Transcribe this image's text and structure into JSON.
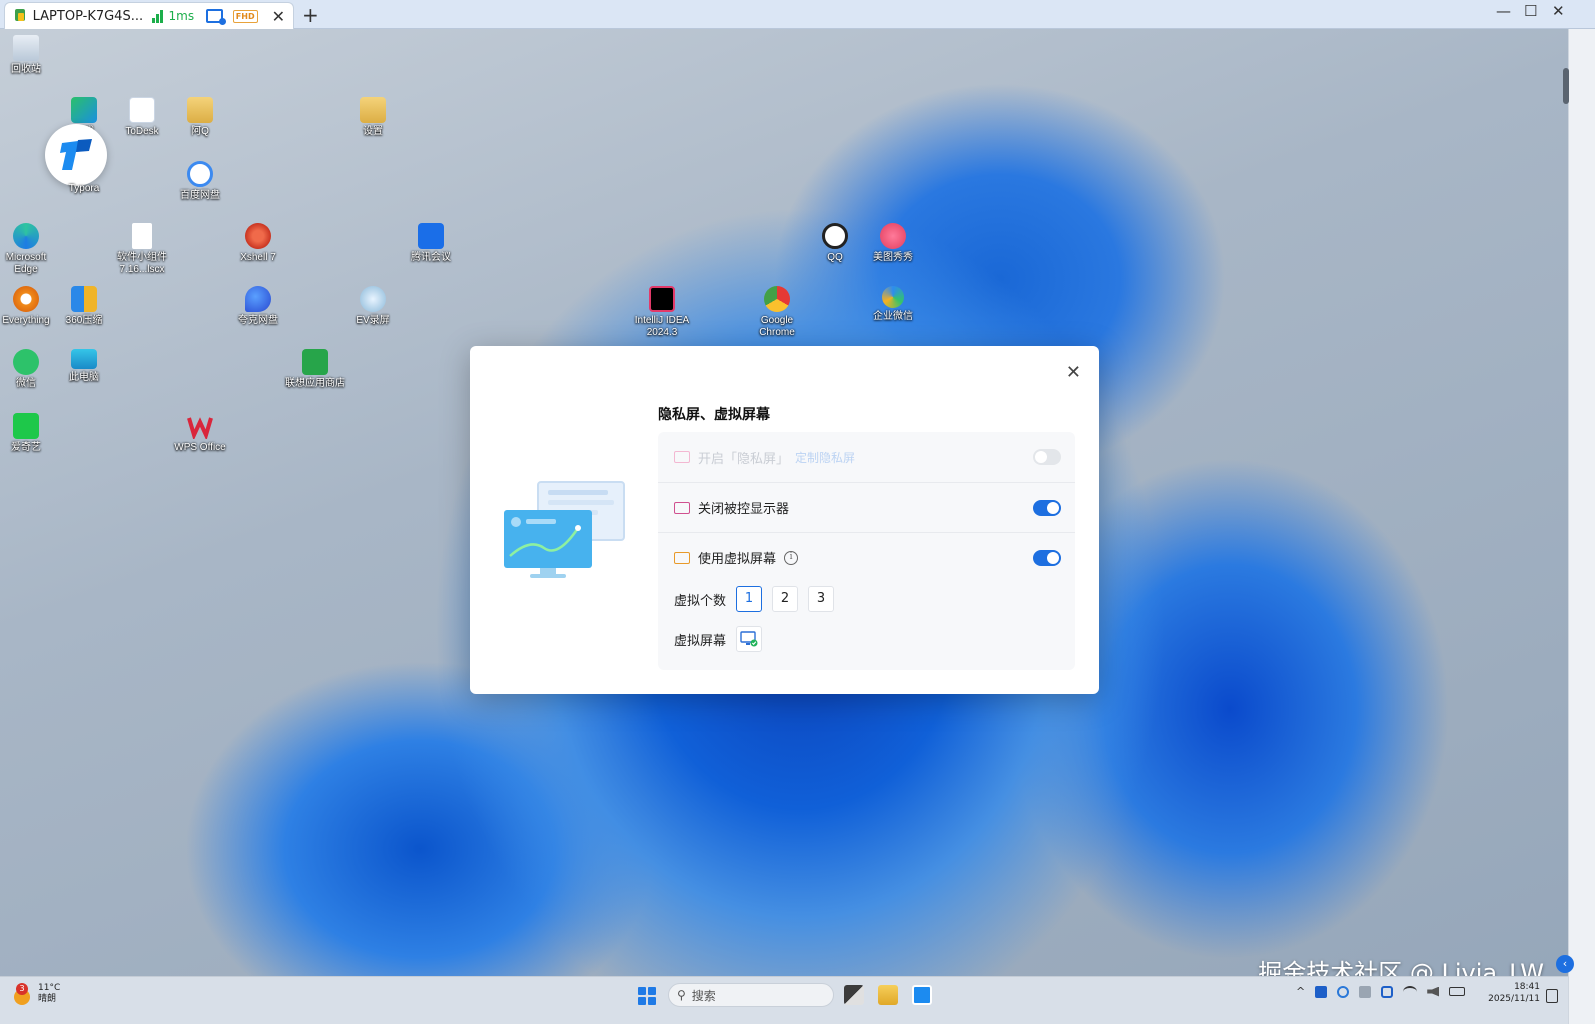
{
  "tab": {
    "title": "LAPTOP-K7G4S...",
    "latency": "1ms",
    "quality_badge": "FHD",
    "close_glyph": "✕",
    "add_glyph": "+"
  },
  "window_controls": {
    "minimize": "—",
    "maximize": "☐",
    "close": "✕"
  },
  "desktop_icons": [
    {
      "label": "回收站"
    },
    {
      "label": "游戏"
    },
    {
      "label": "ToDesk"
    },
    {
      "label": "阿Q"
    },
    {
      "label": "设置"
    },
    {
      "label": "Typora"
    },
    {
      "label": "百度网盘"
    },
    {
      "label": "Microsoft Edge"
    },
    {
      "label": "软件小组件 7.16...lscx"
    },
    {
      "label": "Xshell 7"
    },
    {
      "label": "腾讯会议"
    },
    {
      "label": "QQ"
    },
    {
      "label": "美图秀秀"
    },
    {
      "label": "Everything"
    },
    {
      "label": "360压缩"
    },
    {
      "label": "夸克网盘"
    },
    {
      "label": "EV录屏"
    },
    {
      "label": "IntelliJ IDEA 2024.3"
    },
    {
      "label": "Google Chrome"
    },
    {
      "label": "企业微信"
    },
    {
      "label": "微信"
    },
    {
      "label": "此电脑"
    },
    {
      "label": "联想应用商店"
    },
    {
      "label": "爱奇艺"
    },
    {
      "label": "WPS Office"
    }
  ],
  "watermark": "掘金技术社区 @ Livia_LW",
  "modal": {
    "title": "隐私屏、虚拟屏幕",
    "close_glyph": "✕",
    "rows": [
      {
        "label": "开启「隐私屏」",
        "link": "定制隐私屏",
        "enabled": false,
        "toggle": "off"
      },
      {
        "label": "关闭被控显示器",
        "enabled": true,
        "toggle": "on"
      },
      {
        "label": "使用虚拟屏幕",
        "enabled": true,
        "toggle": "on",
        "has_info": true
      }
    ],
    "info_glyph": "i",
    "virtual_count_label": "虚拟个数",
    "virtual_count_options": [
      "1",
      "2",
      "3"
    ],
    "virtual_count_selected": "1",
    "virtual_screen_label": "虚拟屏幕"
  },
  "taskbar": {
    "weather_badge": "3",
    "weather_temp": "11°C",
    "weather_desc": "晴朗",
    "search_placeholder": "搜索",
    "tray_chevron": "^",
    "time": "18:41",
    "date": "2025/11/11"
  },
  "right_strip_button": "‹",
  "colors": {
    "accent": "#1d6fe0",
    "signal": "#1cae4b",
    "badge": "#e28a1a"
  }
}
